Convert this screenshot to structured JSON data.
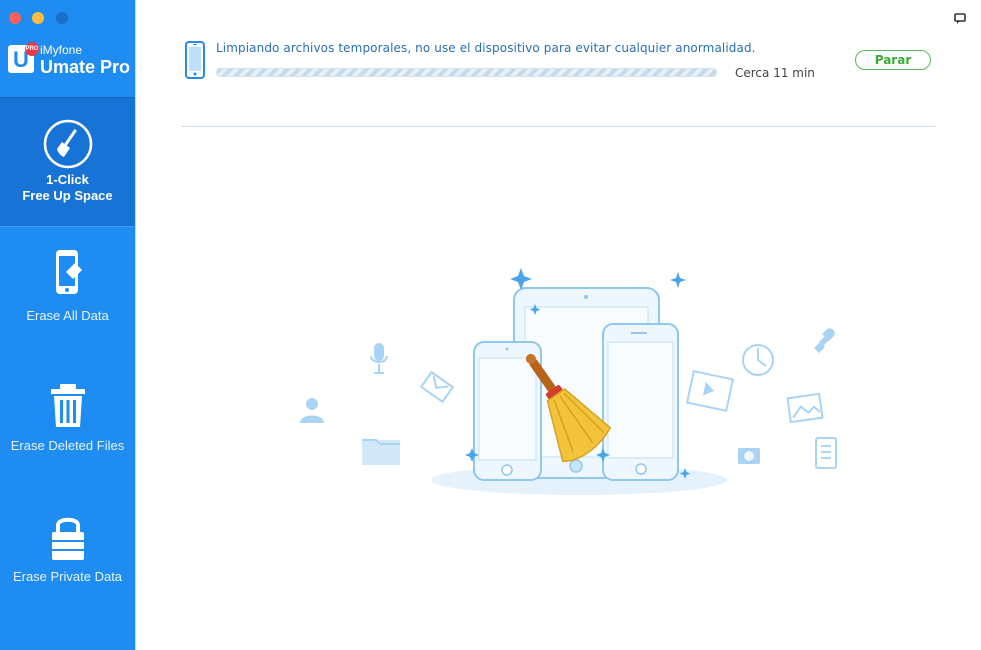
{
  "window": {
    "traffic_lights": [
      "close",
      "minimize",
      "zoom"
    ]
  },
  "brand": {
    "logo_letter": "U",
    "badge": "PRO",
    "small": "iMyfone",
    "big": "Umate Pro"
  },
  "sidebar": {
    "items": [
      {
        "label_line1": "1-Click",
        "label_line2": "Free Up Space",
        "icon": "broom-circle-icon",
        "active": true
      },
      {
        "label": "Erase All Data",
        "icon": "phone-eraser-icon"
      },
      {
        "label": "Erase Deleted Files",
        "icon": "trash-icon"
      },
      {
        "label": "Erase Private Data",
        "icon": "lock-icon"
      }
    ]
  },
  "status": {
    "message": "Limpiando archivos temporales, no use el dispositivo para evitar cualquier anormalidad.",
    "time_left": "Cerca 11 min",
    "stop_label": "Parar"
  },
  "colors": {
    "sidebar": "#1e8cf0",
    "sidebar_active": "#1873d6",
    "accent_green": "#3aa838",
    "text_blue": "#2a6fb3"
  }
}
